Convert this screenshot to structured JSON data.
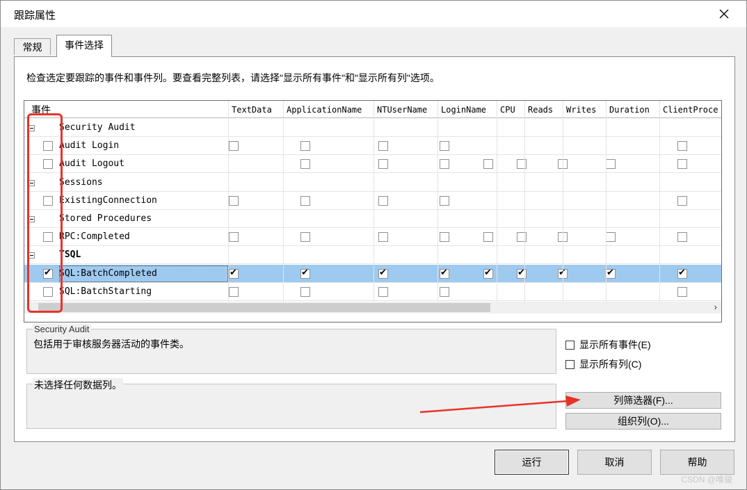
{
  "window": {
    "title": "跟踪属性"
  },
  "tabs": [
    {
      "label": "常规",
      "active": false
    },
    {
      "label": "事件选择",
      "active": true
    }
  ],
  "instruction": "检查选定要跟踪的事件和事件列。要查看完整列表，请选择\"显示所有事件\"和\"显示所有列\"选项。",
  "grid": {
    "columns": [
      "事件",
      "TextData",
      "ApplicationName",
      "NTUserName",
      "LoginName",
      "CPU",
      "Reads",
      "Writes",
      "Duration",
      "ClientProce"
    ],
    "rows": [
      {
        "type": "group",
        "label": "Security Audit",
        "bold": false
      },
      {
        "type": "event",
        "label": "Audit Login",
        "checked": false,
        "cols": [
          1,
          1,
          1,
          1,
          0,
          0,
          0,
          0,
          1
        ]
      },
      {
        "type": "event",
        "label": "Audit Logout",
        "checked": false,
        "cols": [
          0,
          1,
          1,
          1,
          1,
          1,
          1,
          1,
          1
        ]
      },
      {
        "type": "group",
        "label": "Sessions",
        "bold": false
      },
      {
        "type": "event",
        "label": "ExistingConnection",
        "checked": false,
        "cols": [
          1,
          1,
          1,
          1,
          0,
          0,
          0,
          0,
          1
        ]
      },
      {
        "type": "group",
        "label": "Stored Procedures",
        "bold": false
      },
      {
        "type": "event",
        "label": "RPC:Completed",
        "checked": false,
        "cols": [
          1,
          1,
          1,
          1,
          1,
          1,
          1,
          1,
          1
        ]
      },
      {
        "type": "group",
        "label": "TSQL",
        "bold": true
      },
      {
        "type": "event",
        "label": "SQL:BatchCompleted",
        "checked": true,
        "selected": true,
        "cols": [
          2,
          2,
          2,
          2,
          2,
          2,
          2,
          2,
          2
        ]
      },
      {
        "type": "event",
        "label": "SQL:BatchStarting",
        "checked": false,
        "cols": [
          1,
          1,
          1,
          1,
          0,
          0,
          0,
          0,
          1
        ]
      }
    ]
  },
  "details": {
    "group_title": "Security Audit",
    "description": "包括用于审核服务器活动的事件类。",
    "data_columns_title": "未选择任何数据列。"
  },
  "options": {
    "show_all_events": "显示所有事件(E)",
    "show_all_columns": "显示所有列(C)"
  },
  "buttons": {
    "column_filter": "列筛选器(F)...",
    "organize_columns": "组织列(O)...",
    "run": "运行",
    "cancel": "取消",
    "help": "帮助"
  },
  "annotation": {
    "highlight_color": "#e8322a",
    "arrow_color": "#e8322a"
  },
  "watermark": "CSDN @唯骏"
}
